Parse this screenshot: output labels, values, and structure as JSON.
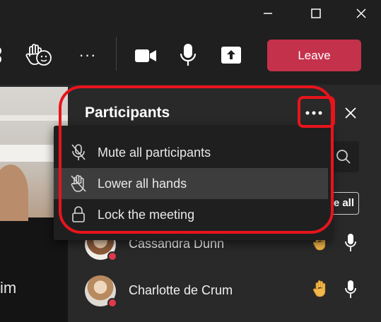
{
  "window": {
    "minimize_icon": "minimize-icon",
    "maximize_icon": "maximize-icon",
    "close_icon": "close-icon"
  },
  "toolbar": {
    "icons": [
      "apps-icon",
      "raise-hand-react-icon",
      "more-actions-icon",
      "camera-icon",
      "microphone-icon",
      "share-screen-icon"
    ],
    "more_label": "···",
    "leave_label": "Leave",
    "leave_color": "#c4314b"
  },
  "stage": {
    "name_fragment": "im"
  },
  "panel": {
    "title": "Participants",
    "more_options_icon": "more-options-icon",
    "close_icon": "close-icon",
    "search_icon": "search-icon",
    "mute_all_fragment": "e all"
  },
  "menu": {
    "items": [
      {
        "label": "Mute all participants",
        "icon": "mic-off-icon"
      },
      {
        "label": "Lower all hands",
        "icon": "hand-off-icon"
      },
      {
        "label": "Lock the meeting",
        "icon": "lock-icon"
      }
    ]
  },
  "participants": [
    {
      "name": "Cassandra Dunn",
      "status_color": "#e03a4a",
      "hand_raised": true,
      "hand_icon": "raised-hand-icon",
      "mic_icon": "microphone-icon"
    },
    {
      "name": "Charlotte de Crum",
      "status_color": "#e03a4a",
      "hand_raised": true,
      "hand_icon": "raised-hand-icon",
      "mic_icon": "microphone-icon"
    }
  ],
  "annotation": {
    "highlight_color": "#e8141c"
  }
}
